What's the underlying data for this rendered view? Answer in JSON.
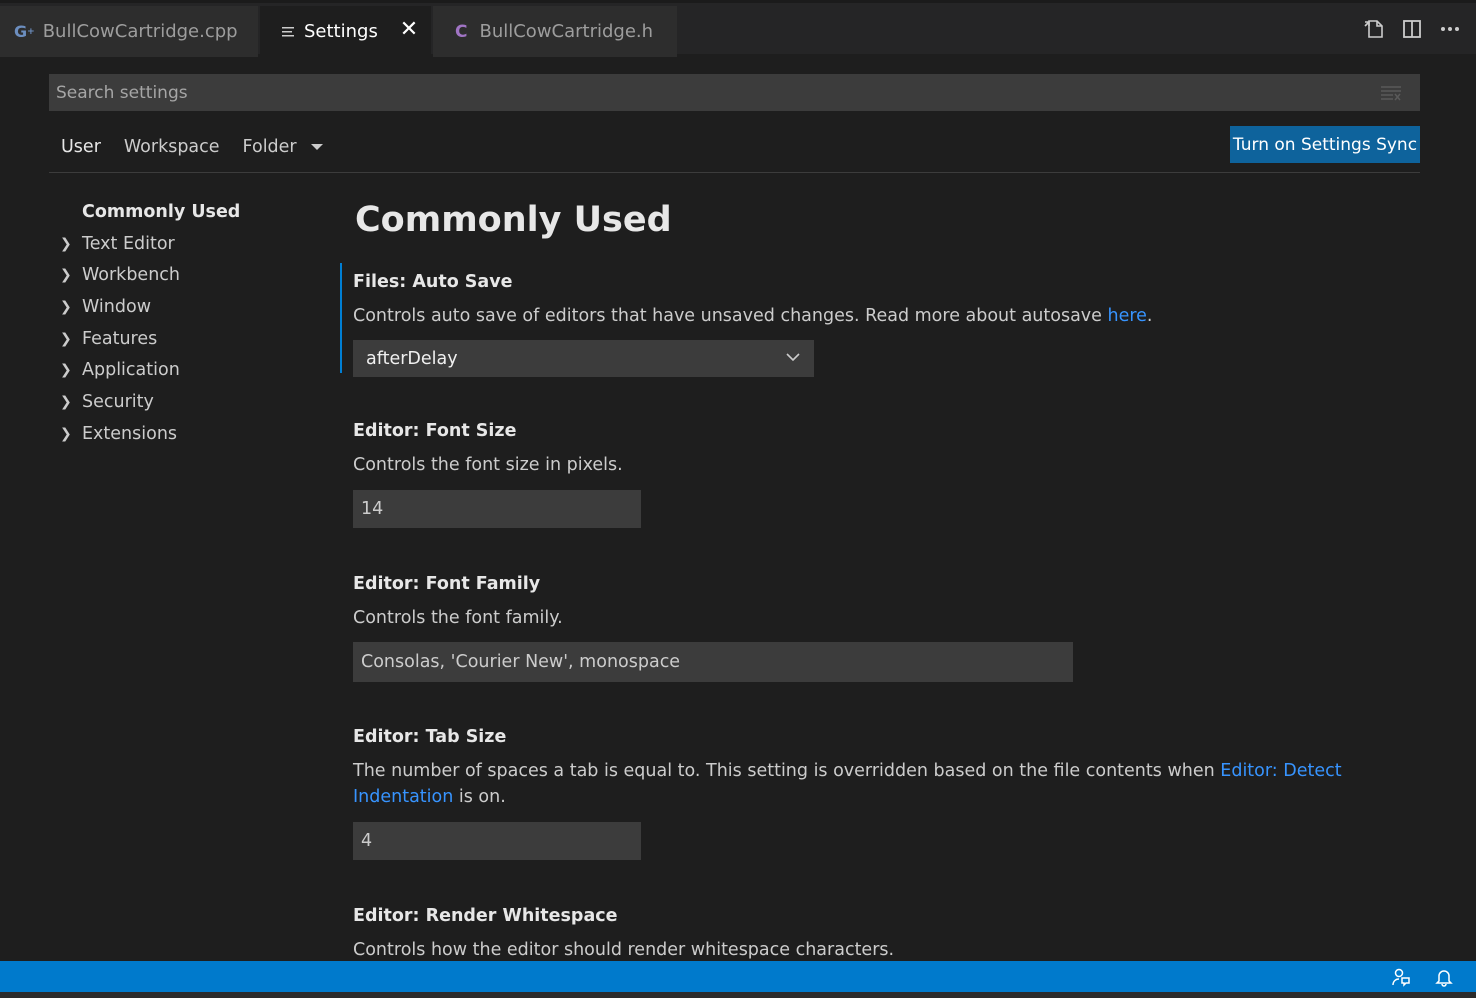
{
  "tabs": [
    {
      "label": "BullCowCartridge.cpp",
      "icon": "cpp-file-icon",
      "icon_glyph": "G",
      "icon_color": "#6c8ebf",
      "active": false
    },
    {
      "label": "Settings",
      "icon": "settings-file-icon",
      "icon_glyph": "≡",
      "active": true,
      "close_glyph": "✕"
    },
    {
      "label": "BullCowCartridge.h",
      "icon": "c-header-file-icon",
      "icon_glyph": "C",
      "icon_color": "#a074c4",
      "active": false
    }
  ],
  "tab_actions": [
    "open-settings-json-icon",
    "split-editor-icon",
    "more-actions-icon"
  ],
  "search": {
    "placeholder": "Search settings"
  },
  "scopes": {
    "user": "User",
    "workspace": "Workspace",
    "folder": "Folder"
  },
  "sync_button": "Turn on Settings Sync",
  "toc": {
    "header": "Commonly Used",
    "items": [
      "Text Editor",
      "Workbench",
      "Window",
      "Features",
      "Application",
      "Security",
      "Extensions"
    ]
  },
  "main": {
    "section_title": "Commonly Used",
    "settings": [
      {
        "category": "Files: ",
        "key": "Auto Save",
        "desc_before": "Controls auto save of editors that have unsaved changes. Read more about autosave ",
        "desc_link": "here",
        "desc_after": ".",
        "value": "afterDelay"
      },
      {
        "category": "Editor: ",
        "key": "Font Size",
        "desc": "Controls the font size in pixels.",
        "value": "14"
      },
      {
        "category": "Editor: ",
        "key": "Font Family",
        "desc": "Controls the font family.",
        "value": "Consolas, 'Courier New', monospace"
      },
      {
        "category": "Editor: ",
        "key": "Tab Size",
        "desc_before": "The number of spaces a tab is equal to. This setting is overridden based on the file contents when ",
        "desc_link": "Editor: Detect Indentation",
        "desc_after": " is on.",
        "value": "4"
      },
      {
        "category": "Editor: ",
        "key": "Render Whitespace",
        "desc": "Controls how the editor should render whitespace characters."
      }
    ]
  },
  "statusbar": {
    "icons": [
      "feedback-icon",
      "notifications-bell-icon"
    ]
  },
  "colors": {
    "accent": "#007acc",
    "button": "#0e639c",
    "link": "#3794ff",
    "background": "#1e1e1e"
  }
}
